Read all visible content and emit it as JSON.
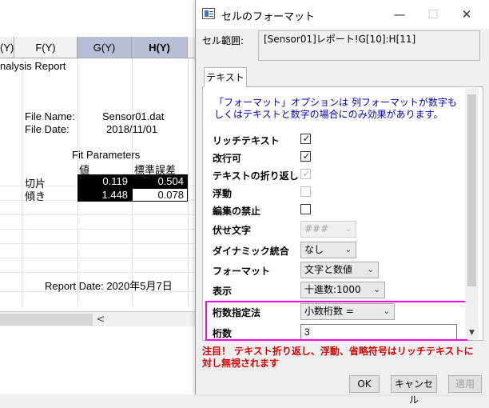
{
  "worksheet": {
    "columns": [
      {
        "label": "(Y)"
      },
      {
        "label": "F(Y)"
      },
      {
        "label": "G(Y)"
      },
      {
        "label": "H(Y)"
      }
    ],
    "report_title": "nalysis Report",
    "file_name_label": "File Name:",
    "file_name_value": "Sensor01.dat",
    "file_date_label": "File Date:",
    "file_date_value": "2018/11/01",
    "fit_params_title": "Fit Parameters",
    "col_value": "値",
    "col_stderr": "標準誤差",
    "rows": [
      {
        "label": "切片",
        "value": "0.119",
        "stderr": "0.504"
      },
      {
        "label": "傾き",
        "value": "1.448",
        "stderr": "0.078"
      }
    ],
    "report_date": "Report Date: 2020年5月7日",
    "scroll_arrow": "<"
  },
  "dialog": {
    "title": "セルのフォーマット",
    "window_buttons": {
      "minimize": "—",
      "maximize": "☐",
      "close": "✕"
    },
    "range_label": "セル範囲:",
    "range_value": "[Sensor01]レポート!G[10]:H[11]",
    "tab_label": "テキスト",
    "info_text": "「フォーマット」オプションは 列フォーマットが数字もしくはテキストと数字の場合にのみ効果があります。",
    "properties": {
      "rich_text": {
        "label": "リッチテキスト",
        "checked": true
      },
      "line_break": {
        "label": "改行可",
        "checked": true
      },
      "wrap_text": {
        "label": "テキストの折り返し",
        "checked": true,
        "disabled": true
      },
      "float": {
        "label": "浮動",
        "checked": false,
        "disabled": true
      },
      "no_edit": {
        "label": "編集の禁止",
        "checked": false
      },
      "mask_chars": {
        "label": "伏せ文字",
        "value": "###"
      },
      "dynamic_merge": {
        "label": "ダイナミック統合",
        "value": "なし"
      },
      "format": {
        "label": "フォーマット",
        "value": "文字と数値"
      },
      "display": {
        "label": "表示",
        "value": "十進数:1000"
      },
      "digits_method": {
        "label": "桁数指定法",
        "value": "小数桁数 ="
      },
      "digits": {
        "label": "桁数",
        "value": "3"
      }
    },
    "warning": "注目！ テキスト折り返し、浮動、省略符号はリッチテキストに対し無視されます",
    "buttons": {
      "ok": "OK",
      "cancel": "キャンセル",
      "apply": "適用"
    },
    "checkmark_glyph": "✓",
    "dropdown_glyph": "⌄",
    "scroll_down_glyph": "▼",
    "highlight_color": "#ff00ff",
    "info_color": "#0000c8",
    "warning_color": "#e00000"
  }
}
